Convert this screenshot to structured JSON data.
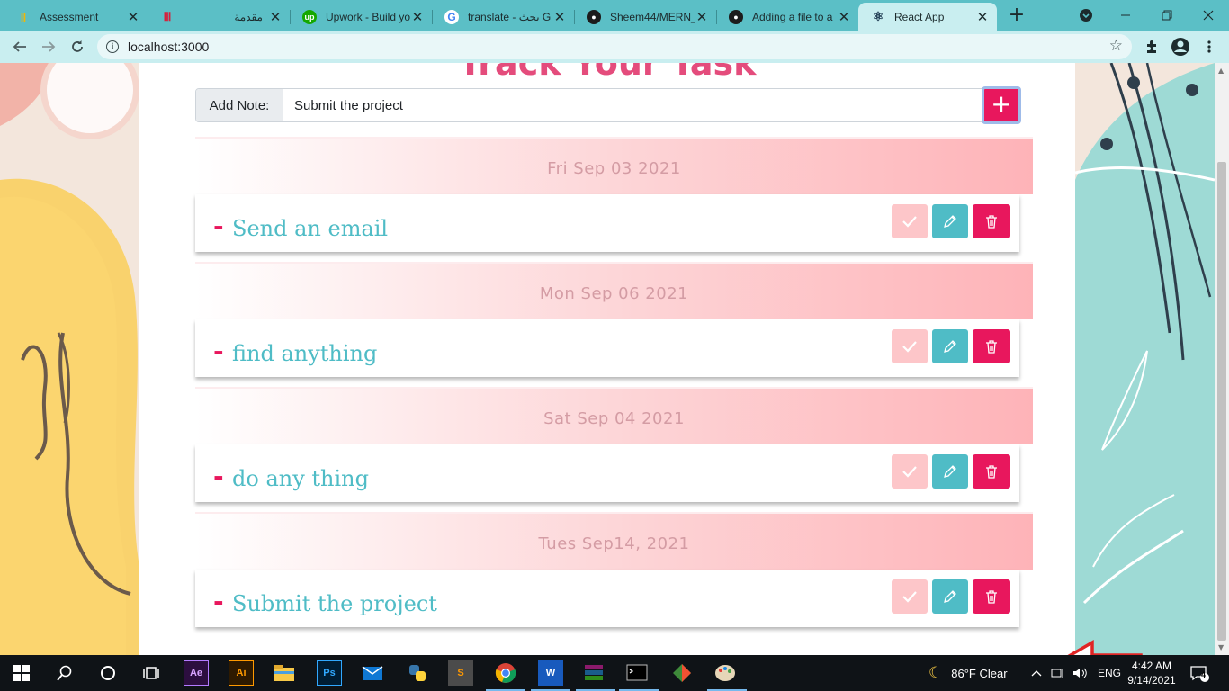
{
  "browser": {
    "tabs": [
      {
        "title": "Assessment",
        "icon": "assessment-favicon",
        "active": false
      },
      {
        "title": "مقدمة",
        "icon": "udemy-favicon",
        "active": false
      },
      {
        "title": "Upwork - Build yo",
        "icon": "upwork-favicon",
        "active": false
      },
      {
        "title": "translate - بحث G",
        "icon": "google-favicon",
        "active": false
      },
      {
        "title": "Sheem44/MERN_",
        "icon": "github-favicon",
        "active": false
      },
      {
        "title": "Adding a file to a",
        "icon": "github-favicon",
        "active": false
      },
      {
        "title": "React App",
        "icon": "react-favicon",
        "active": true
      }
    ],
    "new_tab_label": "+",
    "url": "localhost:3000"
  },
  "app": {
    "title": "Track Your Task",
    "add_note_label": "Add Note:",
    "add_note_value": "Submit the project",
    "add_button_label": "+",
    "groups": [
      {
        "date": "Fri Sep 03 2021",
        "task": "Send an email"
      },
      {
        "date": "Mon Sep 06 2021",
        "task": "find anything"
      },
      {
        "date": "Sat Sep 04 2021",
        "task": "do any thing"
      },
      {
        "date": "Tues Sep14, 2021",
        "task": "Submit the project"
      }
    ],
    "task_prefix": "-",
    "colors": {
      "accent": "#e8175d",
      "teal": "#4fbcc6",
      "done": "#fdc6c9",
      "date_text": "#d49ca4"
    }
  },
  "taskbar": {
    "apps": [
      "ae-icon",
      "ai-icon",
      "file-explorer-icon",
      "ps-icon",
      "mail-icon",
      "python-icon",
      "sublime-icon",
      "chrome-icon",
      "word-icon",
      "winrar-icon",
      "terminal-icon",
      "git-icon",
      "paint-icon"
    ],
    "weather": "86°F  Clear",
    "language": "ENG",
    "time": "4:42 AM",
    "date": "9/14/2021",
    "notifications": "4"
  }
}
